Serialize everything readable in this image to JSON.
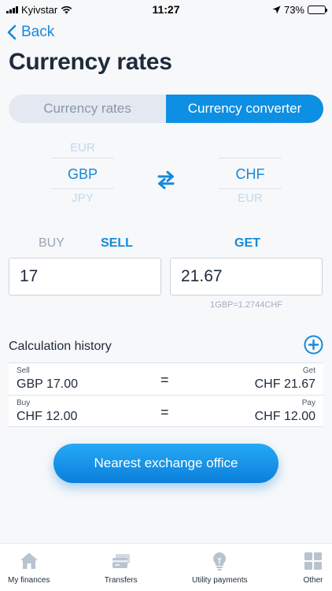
{
  "status_bar": {
    "carrier": "Kyivstar",
    "time": "11:27",
    "battery": "73%",
    "battery_level": 0.73
  },
  "nav": {
    "back_label": "Back"
  },
  "page": {
    "title": "Currency rates"
  },
  "tabs": [
    {
      "label": "Currency rates",
      "active": false
    },
    {
      "label": "Currency converter",
      "active": true
    }
  ],
  "converter": {
    "from": {
      "prev": "EUR",
      "selected": "GBP",
      "next": "JPY"
    },
    "to": {
      "prev": "",
      "selected": "CHF",
      "next": "EUR"
    },
    "buy_label": "BUY",
    "sell_label": "SELL",
    "get_label": "GET",
    "sell_amount": "17",
    "get_amount": "21.67",
    "rate_hint": "1GBP=1.2744CHF"
  },
  "history": {
    "title": "Calculation history",
    "rows": [
      {
        "left_label": "Sell",
        "left_value": "GBP 17.00",
        "eq": "=",
        "right_label": "Get",
        "right_value": "CHF 21.67"
      },
      {
        "left_label": "Buy",
        "left_value": "CHF 12.00",
        "eq": "=",
        "right_label": "Pay",
        "right_value": "CHF 12.00"
      }
    ]
  },
  "cta": {
    "label": "Nearest exchange office"
  },
  "tab_bar": [
    {
      "label": "My finances",
      "icon": "home-icon"
    },
    {
      "label": "Transfers",
      "icon": "cards-icon"
    },
    {
      "label": "Utility payments",
      "icon": "lightbulb-icon"
    },
    {
      "label": "Other",
      "icon": "grid-icon"
    }
  ],
  "colors": {
    "accent": "#0d8fe3",
    "link": "#1589d9",
    "tab_icon": "#b9c2cf"
  }
}
